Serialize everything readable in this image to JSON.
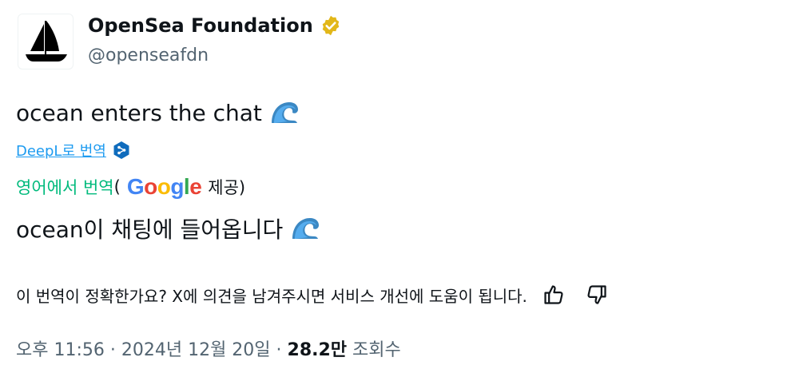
{
  "account": {
    "display_name": "OpenSea Foundation",
    "handle": "@openseafdn",
    "verified_icon": "verified-badge-icon",
    "badge_color": "#e2b719"
  },
  "tweet": {
    "text": "ocean enters the chat",
    "emoji": "water-wave-icon"
  },
  "translation": {
    "deepl_label": "DeepL로 번역",
    "google_prefix": "영어에서 번역",
    "paren_open": "(",
    "google_logo_letters": [
      "G",
      "o",
      "o",
      "g",
      "l",
      "e"
    ],
    "google_logo_colors": [
      "#4285f4",
      "#ea4335",
      "#fbbc05",
      "#4285f4",
      "#34a853",
      "#ea4335"
    ],
    "google_suffix": " 제공)",
    "translated_text": "ocean이 채팅에 들어옵니다"
  },
  "feedback": {
    "question": "이 번역이 정확한가요? X에 의견을 남겨주시면 서비스 개선에 도움이 됩니다.",
    "thumbs_up_icon": "thumbs-up-icon",
    "thumbs_down_icon": "thumbs-down-icon"
  },
  "meta": {
    "time": "오후 11:56",
    "sep1": " · ",
    "date": "2024년 12월 20일",
    "sep2": " · ",
    "views_count": "28.2만",
    "views_label": " 조회수"
  },
  "colors": {
    "link": "#1d9bf0",
    "green": "#00ba7c",
    "secondary_text": "#536471",
    "deepl_blue": "#0f2b46"
  }
}
